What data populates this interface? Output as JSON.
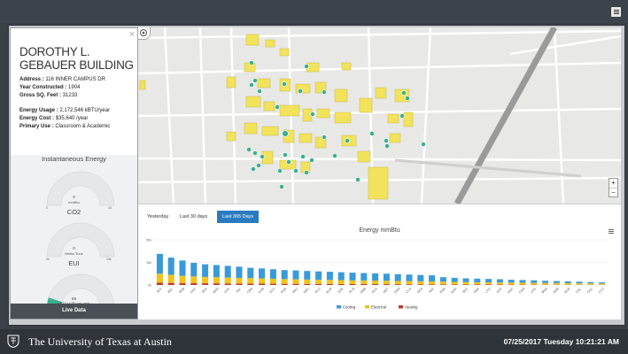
{
  "building": {
    "name": "DOROTHY L. GEBAUER BUILDING",
    "close": "×",
    "address_label": "Address",
    "address": "116 INNER CAMPUS DR",
    "year_label": "Year Constructed",
    "year": "1904",
    "sqft_label": "Gross SQ. Feet",
    "sqft": "31233",
    "usage_label": "Energy Usage",
    "usage": "2,172,546 kBTU/year",
    "cost_label": "Energy Cost",
    "cost": "$35,640 /year",
    "use_label": "Primary Use",
    "use": "Classroom & Academic"
  },
  "gauges": [
    {
      "title": "Instantaneous Energy",
      "value": "0",
      "unit": "mmBtu",
      "min": "0",
      "max": "44"
    },
    {
      "title": "CO2",
      "value": "0",
      "unit": "Metric Tons",
      "min": "0k",
      "max": "15k"
    },
    {
      "title": "EUI",
      "value": "69",
      "unit": "kBTU/ CSF per year",
      "min": "0",
      "max": "700",
      "fraction": 0.1
    }
  ],
  "live_button": "Live Data",
  "tabs": [
    "Yesterday",
    "Last 30 days",
    "Last 365 Days"
  ],
  "active_tab": 2,
  "footer": {
    "university": "The University of Texas at Austin",
    "datetime": "07/25/2017 Tuesday 10:21:21 AM"
  },
  "colors": {
    "cooling": "#3a9ad9",
    "electrical": "#f0c419",
    "heating": "#c0392b",
    "building": "#f2e35b",
    "marker": "#3bb08f"
  },
  "chart_data": {
    "type": "bar",
    "stacked": true,
    "title": "Energy mmBtu",
    "ylim": [
      0,
      50000
    ],
    "yticks": [
      "50k",
      "25k",
      "0k"
    ],
    "yticks_values": [
      50000,
      25000,
      0
    ],
    "legend_position": "bottom",
    "categories": [
      "JES",
      "BEL",
      "NHB",
      "GDC",
      "SEA",
      "NMS",
      "CPE",
      "PAI",
      "CBA",
      "GSB",
      "ETC",
      "PHR",
      "MEZ",
      "WEL",
      "ECJ",
      "BUR",
      "SZB",
      "RLM",
      "MBB",
      "ACA",
      "ART",
      "SSW",
      "CLA",
      "GEA",
      "MAI",
      "ESB",
      "ADH",
      "BIO",
      "PAR",
      "LTD",
      "SJH",
      "RSC",
      "CMA",
      "UTA",
      "BMA",
      "ANB",
      "NOA",
      "CAL",
      "GOL",
      "CCJ"
    ],
    "series": [
      {
        "name": "Cooling",
        "values": [
          22000,
          19000,
          17000,
          15000,
          14000,
          13500,
          13000,
          12500,
          11500,
          11000,
          10500,
          10000,
          9800,
          9500,
          9200,
          9000,
          8700,
          8500,
          8200,
          8000,
          7800,
          7500,
          7200,
          7000,
          6800,
          5000,
          4500,
          4200,
          4000,
          3800,
          3600,
          3200,
          3000,
          2800,
          2500,
          2200,
          2000,
          1800,
          1500,
          1300
        ]
      },
      {
        "name": "Electrical",
        "values": [
          10000,
          9000,
          8000,
          7500,
          7000,
          6800,
          6500,
          6200,
          6000,
          5800,
          5500,
          5200,
          5000,
          4800,
          4600,
          4500,
          4300,
          4100,
          4000,
          3900,
          3800,
          3600,
          3500,
          3300,
          3200,
          3000,
          2800,
          2600,
          2500,
          2400,
          2300,
          2200,
          2100,
          2000,
          1900,
          1800,
          1700,
          1600,
          1500,
          1400
        ]
      },
      {
        "name": "Heating",
        "values": [
          2500,
          2300,
          2100,
          2000,
          1900,
          1800,
          1700,
          1600,
          1500,
          1500,
          1400,
          1300,
          1300,
          1200,
          1200,
          1100,
          1100,
          1000,
          1000,
          950,
          900,
          850,
          800,
          750,
          700,
          650,
          600,
          550,
          500,
          500,
          450,
          400,
          400,
          350,
          300,
          300,
          250,
          250,
          200,
          200
        ]
      }
    ]
  }
}
